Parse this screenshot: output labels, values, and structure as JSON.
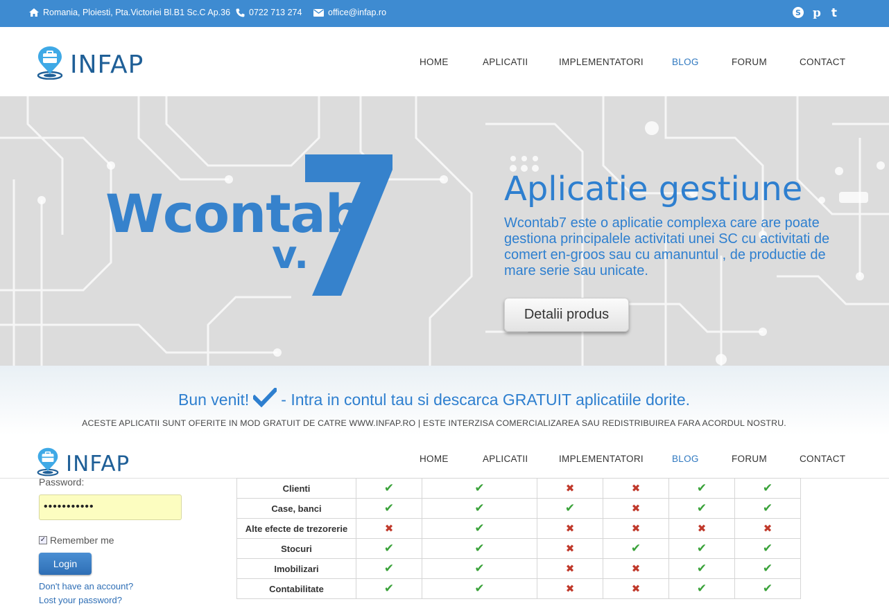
{
  "topbar": {
    "address": "Romania, Ploiesti, Pta.Victoriei Bl.B1 Sc.C Ap.36",
    "phone": "0722 713 274",
    "email": "office@infap.ro",
    "icons": [
      "home-icon",
      "phone-icon",
      "envelope-icon",
      "skype-icon",
      "pinterest-icon",
      "tumblr-icon"
    ]
  },
  "brand": {
    "name": "INFAP"
  },
  "nav": [
    "HOME",
    "APLICATII",
    "IMPLEMENTATORI",
    "BLOG",
    "FORUM",
    "CONTACT"
  ],
  "nav_active": "BLOG",
  "hero": {
    "product_name": "Wcontab",
    "version_prefix": "v.",
    "version_number": "7",
    "title": "Aplicatie gestiune",
    "description": "Wcontab7 este o aplicatie complexa care are poate gestiona principalele activitati unei SC cu activitati de comert en-groos sau cu amanuntul , de productie de mare serie sau unicate.",
    "button": "Detalii produs"
  },
  "welcome": {
    "lead": "Bun venit!",
    "text": "- Intra in contul tau si descarca GRATUIT aplicatiile dorite.",
    "notice": "ACESTE APLICATII SUNT OFERITE IN MOD GRATUIT DE CATRE WWW.INFAP.RO | ESTE INTERZISA COMERCIALIZAREA SAU REDISTRIBUIREA FARA ACORDUL NOSTRU."
  },
  "login": {
    "password_label": "Password:",
    "password_value": "•••••••••••",
    "remember_label": "Remember me",
    "remember_checked": true,
    "button": "Login",
    "no_account": "Don't have an account?",
    "lost_password": "Lost your password?"
  },
  "features_table": {
    "rows": [
      {
        "label": "Clienti",
        "values": [
          "yes",
          "yes",
          "no",
          "no",
          "yes",
          "yes"
        ]
      },
      {
        "label": "Case, banci",
        "values": [
          "yes",
          "yes",
          "yes",
          "no",
          "yes",
          "yes"
        ]
      },
      {
        "label": "Alte efecte de trezorerie",
        "values": [
          "no",
          "yes",
          "no",
          "no",
          "no",
          "no"
        ]
      },
      {
        "label": "Stocuri",
        "values": [
          "yes",
          "yes",
          "no",
          "yes",
          "yes",
          "yes"
        ]
      },
      {
        "label": "Imobilizari",
        "values": [
          "yes",
          "yes",
          "no",
          "no",
          "yes",
          "yes"
        ]
      },
      {
        "label": "Contabilitate",
        "values": [
          "yes",
          "yes",
          "no",
          "no",
          "yes",
          "yes"
        ]
      }
    ]
  },
  "colors": {
    "brand_blue": "#3e8bd1",
    "accent_blue": "#2e7fcf",
    "yes": "#3aa23a",
    "no": "#c0392b"
  }
}
